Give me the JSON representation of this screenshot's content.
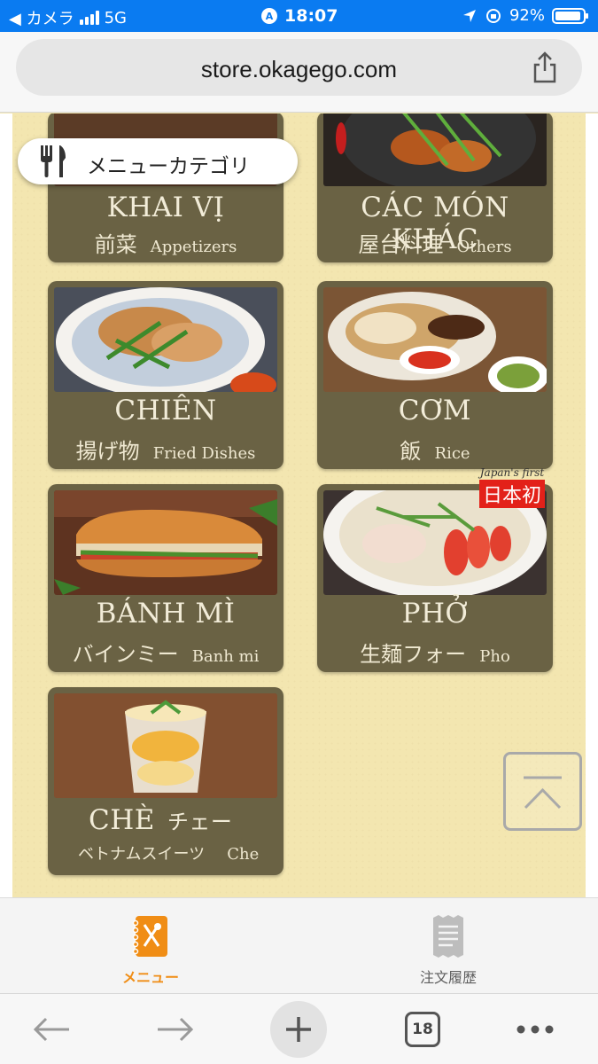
{
  "status_bar": {
    "back_app": "◀ カメラ",
    "network": "5G",
    "time": "18:07",
    "battery": "92%",
    "battery_level": 0.92
  },
  "browser": {
    "url": "store.okagego.com",
    "tab_count": "18"
  },
  "category_button": {
    "label": "メニューカテゴリ"
  },
  "menu_categories": [
    {
      "title": "KHAI VỊ",
      "jp": "前菜",
      "en": "Appetizers"
    },
    {
      "title": "CÁC MÓN KHÁC",
      "jp": "屋台料理",
      "en": "Others"
    },
    {
      "title": "CHIÊN",
      "jp": "揚げ物",
      "en": "Fried Dishes"
    },
    {
      "title": "CƠM",
      "jp": "飯",
      "en": "Rice"
    },
    {
      "title": "BÁNH MÌ",
      "jp": "バインミー",
      "en": "Banh mi"
    },
    {
      "title": "PHỞ",
      "jp": "生麺フォー",
      "en": "Pho"
    },
    {
      "title": "CHÈ",
      "title_jp": "チェー",
      "jp": "ベトナムスイーツ",
      "en": "Che"
    }
  ],
  "badge": {
    "small": "Japan's first",
    "big": "日本初"
  },
  "app_tabs": [
    {
      "label": "メニュー",
      "icon": "menu-book-icon",
      "active": true
    },
    {
      "label": "注文履歴",
      "icon": "receipt-icon",
      "active": false
    }
  ],
  "colors": {
    "status_bar": "#0a7bf1",
    "card": "#6a6244",
    "paper": "#f3e6b0",
    "accent_orange": "#f08d15",
    "badge_red": "#e32119"
  }
}
